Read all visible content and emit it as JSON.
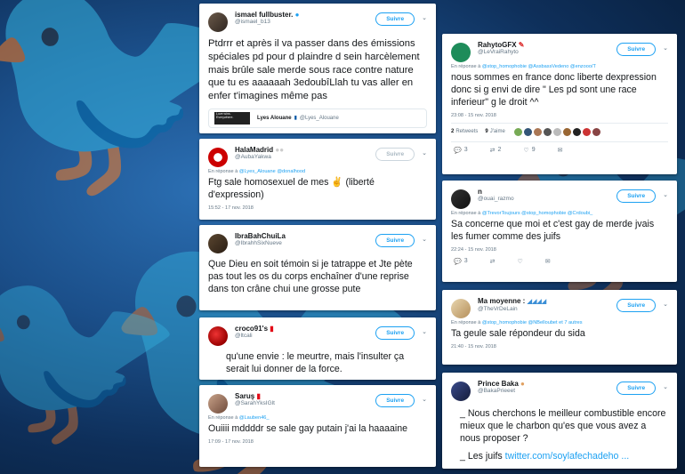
{
  "follow_label": "Suivre",
  "tweets": [
    {
      "display_name": "ismael fullbuster.",
      "handle": "@ismael_b13",
      "text": "Ptdrrr et après il va passer dans des émissions spéciales pd pour d plaindre d sein harcèlement mais brûle sale merde sous race contre nature que tu es aaaaaah 3edoubîLlah tu vas aller en enfer t'imagines même pas",
      "quote": {
        "thumb": "Love wins. Everywhere.",
        "name": "Lyes Alouane",
        "handle": "@Lyes_Alouane"
      }
    },
    {
      "display_name": "HalaMadrid",
      "handle": "@AubaYakwa",
      "reply_prefix": "En réponse à",
      "reply_to": "@Lyes_Alouane @donalhood",
      "text": "Ftg sale homosexuel de mes ✌ (liberté d'expression)",
      "meta": "15:52 - 17 nov. 2018"
    },
    {
      "display_name": "IbraBahChuiLa",
      "handle": "@IbrahhSixNueve",
      "text": "Que Dieu en soit témoin si je tatrappe et Jte pète pas tout les os du corps enchaîner d'une reprise dans ton crâne chui une grosse pute"
    },
    {
      "display_name": "croco91's",
      "handle": "@ltcali",
      "text": "qu'une envie : le meurtre, mais l'insulter ça serait lui donner de la force."
    },
    {
      "display_name": "Saruş",
      "handle": "@SarahYksIGlt",
      "reply_prefix": "En réponse à",
      "reply_to": "@Lauben46_",
      "text": "Ouiiii mddddr se sale gay putain j'ai la haaaaine",
      "meta": "17:09 - 17 nov. 2018"
    },
    {
      "display_name": "RahytoGFX",
      "handle": "@LeVraiRahyto",
      "reply_prefix": "En réponse à",
      "reply_to": "@stop_homophobie @AssbassVedeno @enzooo/T",
      "text": "nous sommes en france donc liberte dexpression donc si g envi de dire \" Les pd sont une race inferieur\" g le droit ^^",
      "meta": "23:08 - 15 nov. 2018",
      "retweets_count": "2",
      "retweets_label": "Retweets",
      "likes_count": "9",
      "likes_label": "J'aime",
      "reply_count": "3",
      "rt_count": "2",
      "like_count": "9"
    },
    {
      "display_name": "n",
      "handle": "@ouai_razmo",
      "reply_prefix": "En réponse à",
      "reply_to": "@TrevorToujours @stop_homophobie @Crdoubi_",
      "text": "Sa concerne que moi et c'est gay de merde jvais les fumer comme des juifs",
      "meta": "22:24 - 15 nov. 2018",
      "reply_count": "3"
    },
    {
      "display_name": "Ma moyenne :",
      "handle": "@TheVrDeLain",
      "reply_prefix": "En réponse à",
      "reply_to": "@stop_homophobie @NBelloubet et 7 autres",
      "text": "Ta geule sale répondeur du sida",
      "meta": "21:40 - 15 nov. 2018"
    },
    {
      "display_name": "Prince Baka",
      "handle": "@BakaPrieeet",
      "text_line1": "_ Nous cherchons le meilleur combustible encore mieux que le charbon qu'es que vous avez a nous proposer ?",
      "text_line2": "_ Les juifs",
      "link": "twitter.com/soylafechadeho ..."
    }
  ]
}
